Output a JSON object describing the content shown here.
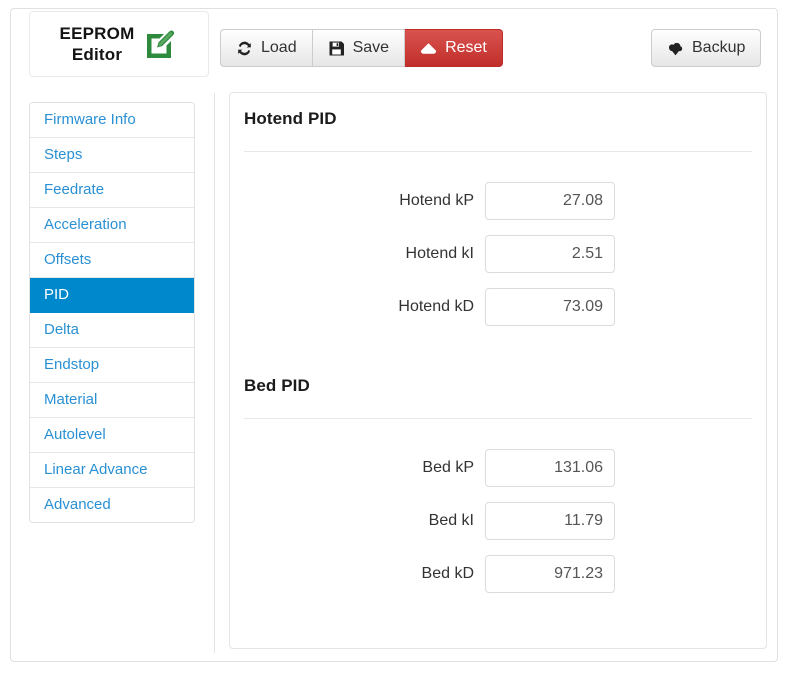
{
  "brand": {
    "line1": "EEPROM",
    "line2": "Editor",
    "icon": "edit-square-pencil-icon"
  },
  "toolbar": {
    "load_label": "Load",
    "load_icon": "refresh-icon",
    "save_label": "Save",
    "save_icon": "floppy-disk-icon",
    "reset_label": "Reset",
    "reset_icon": "eraser-icon",
    "backup_label": "Backup",
    "backup_icon": "cloud-download-icon"
  },
  "colors": {
    "accent_blue": "#0088cc",
    "link_blue": "#2a90d4",
    "danger_red": "#d9534f",
    "brand_green": "#2e8b3d"
  },
  "sidebar": {
    "items": [
      {
        "label": "Firmware Info",
        "active": false
      },
      {
        "label": "Steps",
        "active": false
      },
      {
        "label": "Feedrate",
        "active": false
      },
      {
        "label": "Acceleration",
        "active": false
      },
      {
        "label": "Offsets",
        "active": false
      },
      {
        "label": "PID",
        "active": true
      },
      {
        "label": "Delta",
        "active": false
      },
      {
        "label": "Endstop",
        "active": false
      },
      {
        "label": "Material",
        "active": false
      },
      {
        "label": "Autolevel",
        "active": false
      },
      {
        "label": "Linear Advance",
        "active": false
      },
      {
        "label": "Advanced",
        "active": false
      }
    ]
  },
  "content": {
    "sections": [
      {
        "title": "Hotend PID",
        "fields": [
          {
            "label": "Hotend kP",
            "value": "27.08"
          },
          {
            "label": "Hotend kI",
            "value": "2.51"
          },
          {
            "label": "Hotend kD",
            "value": "73.09"
          }
        ]
      },
      {
        "title": "Bed PID",
        "fields": [
          {
            "label": "Bed kP",
            "value": "131.06"
          },
          {
            "label": "Bed kI",
            "value": "11.79"
          },
          {
            "label": "Bed kD",
            "value": "971.23"
          }
        ]
      }
    ]
  }
}
